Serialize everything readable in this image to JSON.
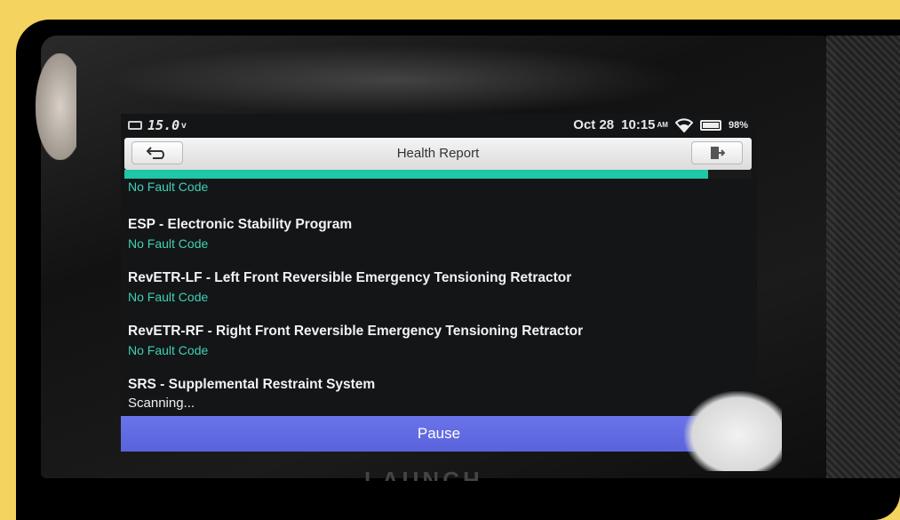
{
  "status_bar": {
    "voltage": "15.0",
    "voltage_unit": "v",
    "date": "Oct 28",
    "time": "10:15",
    "ampm": "AM",
    "battery": "98%"
  },
  "header": {
    "title": "Health Report",
    "back_icon": "back-arrow-icon",
    "exit_icon": "exit-icon"
  },
  "progress": {
    "fraction": 0.93,
    "color": "#1ec7a5"
  },
  "report": {
    "items": [
      {
        "title": "",
        "status": "No Fault Code"
      },
      {
        "title": "ESP - Electronic Stability Program",
        "status": "No Fault Code"
      },
      {
        "title": "RevETR-LF - Left Front Reversible Emergency Tensioning Retractor",
        "status": "No Fault Code"
      },
      {
        "title": "RevETR-RF - Right Front Reversible Emergency Tensioning Retractor",
        "status": "No Fault Code"
      },
      {
        "title": "SRS - Supplemental Restraint System",
        "status": "Scanning..."
      }
    ]
  },
  "footer": {
    "pause_label": "Pause"
  },
  "device": {
    "brand": "LAUNCH"
  },
  "colors": {
    "frame": "#f4d35e",
    "accent_teal": "#1ec7a5",
    "pause_button": "#5a63db"
  }
}
